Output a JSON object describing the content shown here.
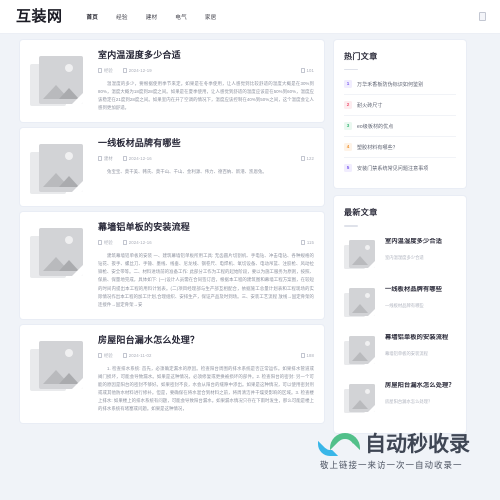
{
  "site": {
    "logo": "互装网",
    "search_icon": "search-icon"
  },
  "nav": {
    "items": [
      {
        "label": "首页",
        "active": true
      },
      {
        "label": "经验",
        "active": false
      },
      {
        "label": "建材",
        "active": false
      },
      {
        "label": "电气",
        "active": false
      },
      {
        "label": "家居",
        "active": false
      }
    ]
  },
  "articles": [
    {
      "title": "室内温湿度多少合适",
      "category": "经验",
      "date": "2024-12-19",
      "views": "101",
      "excerpt": "温湿度的多少，要根据使用季节来定。如果是在冬季使用，让人感觉到比较舒适的温度大概是在30%到80%，温度大概为18度到28度之间。如果是在夏季使用，让人感觉到舒适的温度应该是在50%到60%，温度应该稳定在21度到28度之间。如果室内在开了空调的情况下，温度应该控制在40%到50%之间，这个温度会让人感到更加舒适。"
    },
    {
      "title": "一线板材品牌有哪些",
      "category": "建材",
      "date": "2024-12-16",
      "views": "122",
      "excerpt": "兔宝宝、莫干美、韩氏、莫干山、千山、金利源、伟力、德百纳、新港、凯恩兔。"
    },
    {
      "title": "幕墙铝单板的安装流程",
      "category": "经验",
      "date": "2024-12-16",
      "views": "115",
      "excerpt": "建筑幕墙铝单板的安装 一、建筑幕墙铝单板所用工具: 无齿圆片切割机、手电钻、冲击电钻、各种规格的钻花、扳手、螺丝刀、手锤、墨线、线垂、尼龙线、钢卷尺、电焊机、氧切设备、电动吊篮、注胶枪、风动拉铆枪、安全带等。二、材料进场前的准备工作: 此部分工作为工程的起始阶段，要以为施工服务为原则，按照、保质、保量地完成，具体如下: (一)设计人员需在合同签订后，根据本工程的建筑图和幕墙工程方案图，在较短的时间内提出本工程的用料计划表。(二)项目经理部与生产部互相配合，依据施工总量计划表和工程现场的实际情况作出本工程的加工计划,合理组织、安排生产，保证产品及时到场。三、安装工艺流程 放线→固定骨架的连接件→固定骨架→安"
    },
    {
      "title": "房屋阳台漏水怎么处理？",
      "category": "经验",
      "date": "2024-11-02",
      "views": "188",
      "excerpt": "1. 检查排水系统: 首先，必须确定漏水的原因。检查阳台周围的排水系统是否正常运作。如果排水管道或阀门损坏，可能会导致漏水。如果是这种情况，必须修复或更换被损坏的部件。2. 检查阳台的密封: 另一个可能的原因是阳台的密封不够好。如果密封不良，水会从阳台的缝隙中渗出。如果是这种情况，可以使用密封剂或或其他防水材料进行修补。但是，要确保在将水混合到材料之前，将周清洁并干燥受影响的区域。3. 检查楼上排水: 如果楼上的排水系统有问题，可能会导致阳台漏水。如果漏水情况只存在下雨时发生，那么可能是楼上的排水系统有堵塞或问题。如果是这种情况，"
    }
  ],
  "sidebar": {
    "hot": {
      "title": "热门文章",
      "items": [
        {
          "rank": "1",
          "label": "万华禾香板防伪标识如何鉴别",
          "color": "#7b5cf0",
          "bg": "#f1edfe"
        },
        {
          "rank": "2",
          "label": "耐火砖尺寸",
          "color": "#f0506e",
          "bg": "#fdecef"
        },
        {
          "rank": "3",
          "label": "eo级板材的优点",
          "color": "#3bb878",
          "bg": "#eaf8f0"
        },
        {
          "rank": "4",
          "label": "塑胶材料有哪些？",
          "color": "#f0922e",
          "bg": "#fef3e7"
        },
        {
          "rank": "5",
          "label": "安装门禁系统常见问题注意事项",
          "color": "#7b5cf0",
          "bg": "#f1edfe"
        }
      ]
    },
    "latest": {
      "title": "最新文章",
      "items": [
        {
          "title": "室内温湿度多少合适",
          "desc": "室内温湿度多少合适"
        },
        {
          "title": "一线板材品牌有哪些",
          "desc": "一线板材品牌有哪些"
        },
        {
          "title": "幕墙铝单板的安装流程",
          "desc": "幕墙铝单板的安装流程"
        },
        {
          "title": "房屋阳台漏水怎么处理？",
          "desc": "房屋阳台漏水怎么处理？"
        }
      ]
    }
  },
  "watermark": {
    "text": "自动秒收录",
    "subtitle": "敬上链接一来访一次一自动收录一"
  }
}
